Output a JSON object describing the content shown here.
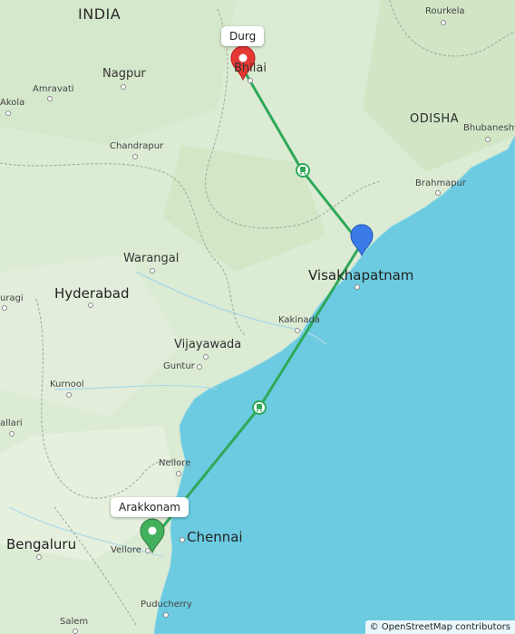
{
  "map": {
    "region_labels": [
      {
        "id": "india",
        "text": "INDIA"
      },
      {
        "id": "odisha",
        "text": "ODISHA"
      }
    ],
    "cities": [
      {
        "id": "nagpur",
        "text": "Nagpur"
      },
      {
        "id": "amravati",
        "text": "Amravati"
      },
      {
        "id": "akola",
        "text": "Akola"
      },
      {
        "id": "chandrapur",
        "text": "Chandrapur"
      },
      {
        "id": "rourkela",
        "text": "Rourkela"
      },
      {
        "id": "bhilai",
        "text": "Bhilai"
      },
      {
        "id": "bhubaneswar",
        "text": "Bhubaneshw"
      },
      {
        "id": "brahmapur",
        "text": "Brahmapur"
      },
      {
        "id": "warangal",
        "text": "Warangal"
      },
      {
        "id": "hyderabad",
        "text": "Hyderabad"
      },
      {
        "id": "visakhapatnam",
        "text": "Visakhapatnam"
      },
      {
        "id": "kakinada",
        "text": "Kakinada"
      },
      {
        "id": "vijayawada",
        "text": "Vijayawada"
      },
      {
        "id": "guntur",
        "text": "Guntur"
      },
      {
        "id": "kurnool",
        "text": "Kurnool"
      },
      {
        "id": "nellore",
        "text": "Nellore"
      },
      {
        "id": "chennai",
        "text": "Chennai"
      },
      {
        "id": "bengaluru",
        "text": "Bengaluru"
      },
      {
        "id": "vellore",
        "text": "Vellore"
      },
      {
        "id": "puducherry",
        "text": "Puducherry"
      },
      {
        "id": "salem",
        "text": "Salem"
      },
      {
        "id": "uragi",
        "text": "uragi"
      },
      {
        "id": "allari",
        "text": "allari"
      }
    ],
    "markers": {
      "start": {
        "label": "Durg",
        "color": "#e53935"
      },
      "via": {
        "color": "#3b7be8"
      },
      "end": {
        "label": "Arakkonam",
        "color": "#43b05c"
      }
    },
    "route_color": "#2fa85a",
    "water_color": "#6ccbe0",
    "attribution": "© OpenStreetMap contributors"
  }
}
